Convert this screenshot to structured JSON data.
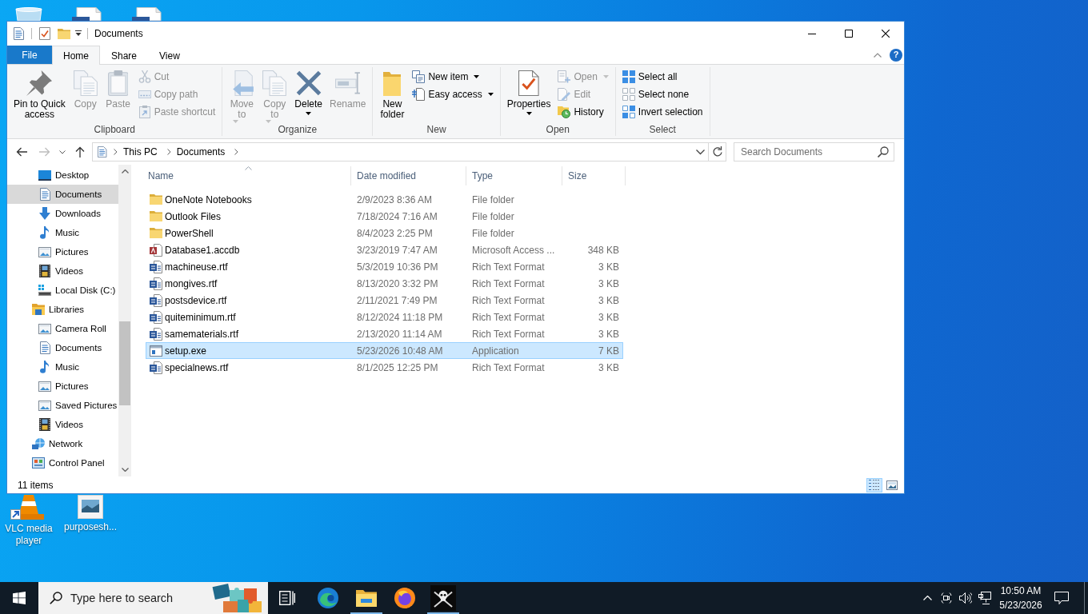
{
  "window": {
    "title": "Documents"
  },
  "ribbon": {
    "file_tab": "File",
    "tabs": [
      {
        "label": "Home",
        "selected": true
      },
      {
        "label": "Share",
        "selected": false
      },
      {
        "label": "View",
        "selected": false
      }
    ],
    "help": "?",
    "groups": [
      {
        "label": "Clipboard",
        "buttons": [
          {
            "label": "Pin to Quick access",
            "kind": "large",
            "disabled": false,
            "dropdown": false
          },
          {
            "label": "Copy",
            "kind": "large",
            "disabled": true,
            "dropdown": false
          },
          {
            "label": "Paste",
            "kind": "large",
            "disabled": true,
            "dropdown": false
          },
          {
            "label": "Cut",
            "kind": "small",
            "disabled": true,
            "dropdown": false
          },
          {
            "label": "Copy path",
            "kind": "small",
            "disabled": true,
            "dropdown": false
          },
          {
            "label": "Paste shortcut",
            "kind": "small",
            "disabled": true,
            "dropdown": false
          }
        ]
      },
      {
        "label": "Organize",
        "buttons": [
          {
            "label": "Move to",
            "kind": "large",
            "disabled": true,
            "dropdown": true
          },
          {
            "label": "Copy to",
            "kind": "large",
            "disabled": true,
            "dropdown": true
          },
          {
            "label": "Delete",
            "kind": "large",
            "disabled": false,
            "dropdown": true
          },
          {
            "label": "Rename",
            "kind": "large",
            "disabled": true,
            "dropdown": false
          }
        ]
      },
      {
        "label": "New",
        "buttons": [
          {
            "label": "New folder",
            "kind": "large",
            "disabled": false,
            "dropdown": false
          },
          {
            "label": "New item",
            "kind": "small",
            "disabled": false,
            "dropdown": true
          },
          {
            "label": "Easy access",
            "kind": "small",
            "disabled": false,
            "dropdown": true
          }
        ]
      },
      {
        "label": "Open",
        "buttons": [
          {
            "label": "Properties",
            "kind": "large",
            "disabled": false,
            "dropdown": true
          },
          {
            "label": "Open",
            "kind": "small",
            "disabled": true,
            "dropdown": true
          },
          {
            "label": "Edit",
            "kind": "small",
            "disabled": true,
            "dropdown": false
          },
          {
            "label": "History",
            "kind": "small",
            "disabled": false,
            "dropdown": false
          }
        ]
      },
      {
        "label": "Select",
        "buttons": [
          {
            "label": "Select all",
            "kind": "small",
            "disabled": false,
            "dropdown": false
          },
          {
            "label": "Select none",
            "kind": "small",
            "disabled": false,
            "dropdown": false
          },
          {
            "label": "Invert selection",
            "kind": "small",
            "disabled": false,
            "dropdown": false
          }
        ]
      }
    ]
  },
  "address_bar": {
    "back_disabled": false,
    "forward_disabled": true,
    "path": [
      "This PC",
      "Documents"
    ]
  },
  "search": {
    "placeholder": "Search Documents"
  },
  "navigation": {
    "items": [
      {
        "children": [
          {
            "label": "Desktop",
            "selected": false
          },
          {
            "label": "Documents",
            "selected": true
          },
          {
            "label": "Downloads",
            "selected": false
          },
          {
            "label": "Music",
            "selected": false
          },
          {
            "label": "Pictures",
            "selected": false
          },
          {
            "label": "Videos",
            "selected": false
          },
          {
            "label": "Local Disk (C:)",
            "selected": false
          }
        ]
      },
      {
        "label": "Libraries",
        "selected": false,
        "children": [
          {
            "label": "Camera Roll",
            "selected": false
          },
          {
            "label": "Documents",
            "selected": false
          },
          {
            "label": "Music",
            "selected": false
          },
          {
            "label": "Pictures",
            "selected": false
          },
          {
            "label": "Saved Pictures",
            "selected": false
          },
          {
            "label": "Videos",
            "selected": false
          }
        ]
      },
      {
        "label": "Network",
        "selected": false
      },
      {
        "label": "Control Panel",
        "selected": false
      }
    ]
  },
  "file_list": {
    "columns": [
      {
        "label": "Name",
        "sorted": true
      },
      {
        "label": "Date modified",
        "sorted": false
      },
      {
        "label": "Type",
        "sorted": false
      },
      {
        "label": "Size",
        "sorted": false
      }
    ],
    "rows": [
      {
        "kind": "folder",
        "name": "OneNote Notebooks",
        "date": "2/9/2023 8:36 AM",
        "type": "File folder",
        "selected": false
      },
      {
        "kind": "folder",
        "name": "Outlook Files",
        "date": "7/18/2024 7:16 AM",
        "type": "File folder",
        "selected": false
      },
      {
        "kind": "folder",
        "name": "PowerShell",
        "date": "8/4/2023 2:25 PM",
        "type": "File folder",
        "selected": false
      },
      {
        "kind": "database",
        "name": "Database1.accdb",
        "date": "3/23/2019 7:47 AM",
        "type": "Microsoft Access ...",
        "size": "348 KB",
        "selected": false
      },
      {
        "kind": "document",
        "name": "machineuse.rtf",
        "date": "5/3/2019 10:36 PM",
        "type": "Rich Text Format",
        "size": "3 KB",
        "selected": false
      },
      {
        "kind": "document",
        "name": "mongives.rtf",
        "date": "8/13/2020 3:32 PM",
        "type": "Rich Text Format",
        "size": "3 KB",
        "selected": false
      },
      {
        "kind": "document",
        "name": "postsdevice.rtf",
        "date": "2/11/2021 7:49 PM",
        "type": "Rich Text Format",
        "size": "3 KB",
        "selected": false
      },
      {
        "kind": "document",
        "name": "quiteminimum.rtf",
        "date": "8/12/2024 11:18 PM",
        "type": "Rich Text Format",
        "size": "3 KB",
        "selected": false
      },
      {
        "kind": "document",
        "name": "samematerials.rtf",
        "date": "2/13/2020 11:14 AM",
        "type": "Rich Text Format",
        "size": "3 KB",
        "selected": false
      },
      {
        "kind": "application",
        "name": "setup.exe",
        "date": "5/23/2026 10:48 AM",
        "type": "Application",
        "size": "7 KB",
        "selected": true
      },
      {
        "kind": "document",
        "name": "specialnews.rtf",
        "date": "8/1/2025 12:25 PM",
        "type": "Rich Text Format",
        "size": "3 KB",
        "selected": false
      }
    ]
  },
  "status_bar": {
    "item_count": "11 items",
    "view_buttons": [
      {
        "selected": true
      },
      {
        "selected": false
      }
    ]
  },
  "desktop": {
    "icons": [
      {
        "label": "VLC media player"
      },
      {
        "label": "purposesh..."
      }
    ]
  },
  "taskbar": {
    "search_placeholder": "Type here to search",
    "apps": [
      {
        "running": false
      },
      {
        "running": true
      },
      {
        "running": false
      },
      {
        "running": true
      }
    ],
    "clock": {
      "time": "10:50 AM",
      "date": "5/23/2026"
    }
  }
}
